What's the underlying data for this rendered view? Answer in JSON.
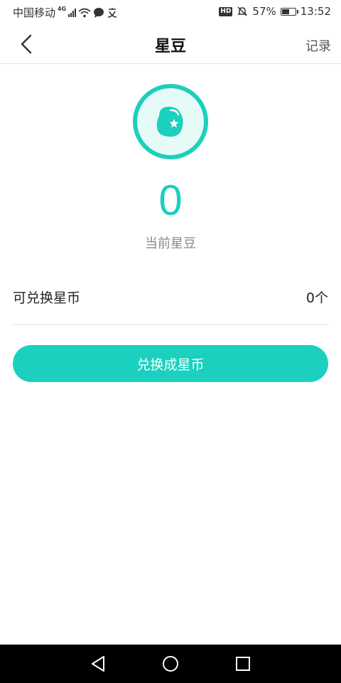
{
  "status_bar": {
    "carrier": "中国移动",
    "network": "4G",
    "battery_percent": "57%",
    "battery_level": 0.57,
    "time": "13:52",
    "hd": "HD"
  },
  "header": {
    "title": "星豆",
    "record_label": "记录"
  },
  "balance": {
    "value": "0",
    "label": "当前星豆"
  },
  "exchange": {
    "label": "可兑换星币",
    "count": "0个"
  },
  "exchange_button_label": "兑换成星币",
  "colors": {
    "accent": "#1bd0bf",
    "icon_bg": "#e6fbf8"
  },
  "icons": {
    "back": "chevron-left-icon",
    "bean": "bean-star-icon",
    "sys_back": "triangle-back-icon",
    "sys_home": "circle-home-icon",
    "sys_recent": "square-recent-icon"
  }
}
